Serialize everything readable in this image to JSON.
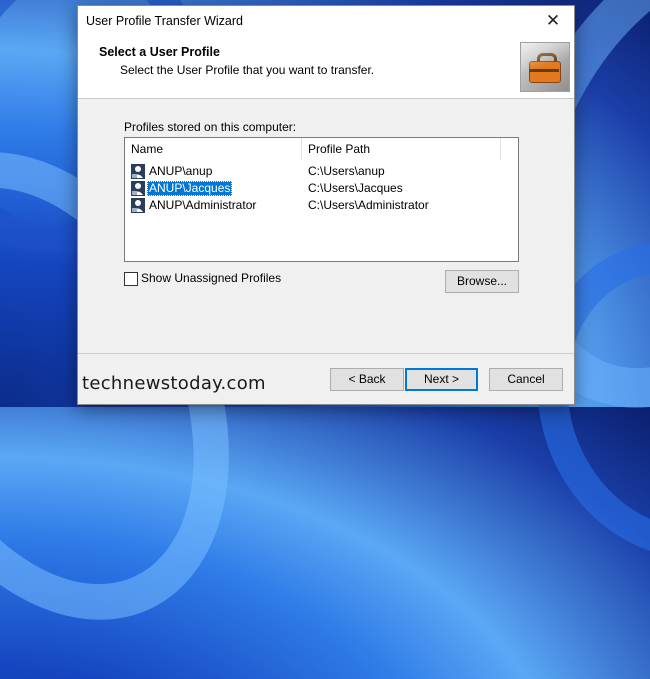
{
  "window": {
    "title": "User Profile Transfer Wizard",
    "close_glyph": "✕"
  },
  "header": {
    "title": "Select a User Profile",
    "subtitle": "Select the User Profile that you want to transfer.",
    "image_icon": "briefcase-icon"
  },
  "profiles": {
    "label": "Profiles stored on this computer:",
    "columns": [
      "Name",
      "Profile Path"
    ],
    "rows": [
      {
        "name": "ANUP\\anup",
        "path": "C:\\Users\\anup",
        "selected": false
      },
      {
        "name": "ANUP\\Jacques",
        "path": "C:\\Users\\Jacques",
        "selected": true
      },
      {
        "name": "ANUP\\Administrator",
        "path": "C:\\Users\\Administrator",
        "selected": false
      }
    ],
    "row_icon": "user-profile-icon"
  },
  "options": {
    "show_unassigned_label": "Show Unassigned Profiles",
    "show_unassigned_checked": false
  },
  "buttons": {
    "browse": "Browse...",
    "back": "< Back",
    "next": "Next >",
    "cancel": "Cancel"
  },
  "watermark": {
    "text": "technewstoday.com"
  },
  "colors": {
    "selection": "#0078d7",
    "dialog_bg": "#f0f0f0",
    "default_button_border": "#0078d7"
  }
}
